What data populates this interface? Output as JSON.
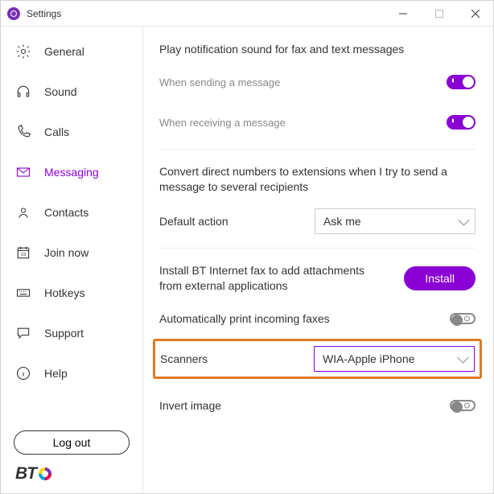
{
  "titlebar": {
    "title": "Settings"
  },
  "sidebar": {
    "items": [
      {
        "label": "General"
      },
      {
        "label": "Sound"
      },
      {
        "label": "Calls"
      },
      {
        "label": "Messaging"
      },
      {
        "label": "Contacts"
      },
      {
        "label": "Join now"
      },
      {
        "label": "Hotkeys"
      },
      {
        "label": "Support"
      },
      {
        "label": "Help"
      }
    ],
    "logout": "Log out",
    "brand": "BT"
  },
  "content": {
    "notification_heading": "Play notification sound for fax and text messages",
    "sending_label": "When sending a message",
    "sending_on": true,
    "receiving_label": "When receiving a message",
    "receiving_on": true,
    "convert_heading": "Convert direct numbers to extensions when I try to send a message to several recipients",
    "default_action_label": "Default action",
    "default_action_value": "Ask me",
    "install_text": "Install BT Internet fax to add attachments from external applications",
    "install_button": "Install",
    "auto_print_label": "Automatically print incoming faxes",
    "auto_print_on": false,
    "scanners_label": "Scanners",
    "scanners_value": "WIA-Apple iPhone",
    "invert_label": "Invert image",
    "invert_on": false
  }
}
